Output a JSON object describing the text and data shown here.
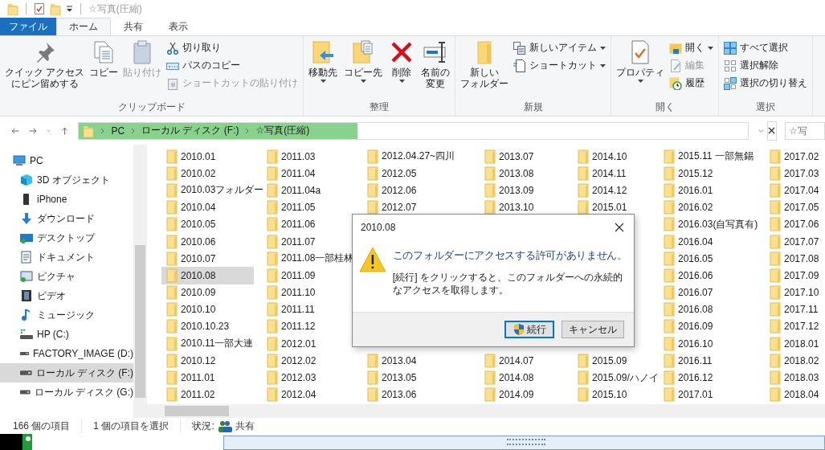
{
  "title_bar": {
    "title": "☆写真(圧縮)"
  },
  "ribbon": {
    "tabs": [
      {
        "label": "ファイル",
        "kind": "file",
        "selected": false
      },
      {
        "label": "ホーム",
        "kind": "tab",
        "selected": true
      },
      {
        "label": "共有",
        "kind": "tab",
        "selected": false
      },
      {
        "label": "表示",
        "kind": "tab",
        "selected": false
      }
    ],
    "groups": [
      {
        "label": "クリップボード",
        "large": [
          {
            "lines": [
              "クイック アクセス",
              "にピン留めする"
            ],
            "disabled": false,
            "dropdown": false
          },
          {
            "lines": [
              "コピー"
            ],
            "disabled": false,
            "dropdown": false
          },
          {
            "lines": [
              "貼り付け"
            ],
            "disabled": true,
            "dropdown": false
          }
        ],
        "small": [
          {
            "label": "切り取り",
            "disabled": false,
            "dropdown": false
          },
          {
            "label": "パスのコピー",
            "disabled": false,
            "dropdown": false
          },
          {
            "label": "ショートカットの貼り付け",
            "disabled": true,
            "dropdown": false
          }
        ]
      },
      {
        "label": "整理",
        "large": [
          {
            "lines": [
              "移動先"
            ],
            "disabled": false,
            "dropdown": true
          },
          {
            "lines": [
              "コピー先"
            ],
            "disabled": false,
            "dropdown": true
          },
          {
            "lines": [
              "削除"
            ],
            "disabled": false,
            "dropdown": true
          },
          {
            "lines": [
              "名前の",
              "変更"
            ],
            "disabled": false,
            "dropdown": false
          }
        ]
      },
      {
        "label": "新規",
        "large": [
          {
            "lines": [
              "新しい",
              "フォルダー"
            ],
            "disabled": false,
            "dropdown": false
          }
        ],
        "small": [
          {
            "label": "新しいアイテム",
            "disabled": false,
            "dropdown": true
          },
          {
            "label": "ショートカット",
            "disabled": false,
            "dropdown": true
          }
        ]
      },
      {
        "label": "開く",
        "large": [
          {
            "lines": [
              "プロパティ"
            ],
            "disabled": false,
            "dropdown": true
          }
        ],
        "small": [
          {
            "label": "開く",
            "disabled": false,
            "dropdown": true
          },
          {
            "label": "編集",
            "disabled": true,
            "dropdown": false
          },
          {
            "label": "履歴",
            "disabled": false,
            "dropdown": false
          }
        ]
      },
      {
        "label": "選択",
        "small": [
          {
            "label": "すべて選択",
            "disabled": false,
            "dropdown": false
          },
          {
            "label": "選択解除",
            "disabled": false,
            "dropdown": false
          },
          {
            "label": "選択の切り替え",
            "disabled": false,
            "dropdown": false
          }
        ]
      }
    ]
  },
  "address": {
    "highlighted": true,
    "crumbs": [
      "PC",
      "ローカル ディスク (F:)",
      "☆写真(圧縮)"
    ],
    "search_placeholder": "☆写"
  },
  "sidebar": {
    "items": [
      {
        "label": "PC",
        "selected": false,
        "children": [
          {
            "label": "3D オブジェクト",
            "selected": false
          },
          {
            "label": "iPhone",
            "selected": false
          },
          {
            "label": "ダウンロード",
            "selected": false
          },
          {
            "label": "デスクトップ",
            "selected": false
          },
          {
            "label": "ドキュメント",
            "selected": false
          },
          {
            "label": "ピクチャ",
            "selected": false
          },
          {
            "label": "ビデオ",
            "selected": false
          },
          {
            "label": "ミュージック",
            "selected": false
          },
          {
            "label": "HP (C:)",
            "selected": false
          },
          {
            "label": "FACTORY_IMAGE (D:)",
            "selected": false
          },
          {
            "label": "ローカル ディスク (F:)",
            "selected": true
          },
          {
            "label": "ローカル ディスク (G:)",
            "selected": false
          }
        ]
      }
    ]
  },
  "files": {
    "columns": [
      {
        "top": [
          {
            "name": "2010.01",
            "selected": false
          },
          {
            "name": "2010.02",
            "selected": false
          },
          {
            "name": "2010.03フォルダー",
            "selected": false
          },
          {
            "name": "2010.04",
            "selected": false
          },
          {
            "name": "2010.05",
            "selected": false
          },
          {
            "name": "2010.06",
            "selected": false
          },
          {
            "name": "2010.07",
            "selected": false
          },
          {
            "name": "2010.08",
            "selected": true
          },
          {
            "name": "2010.09",
            "selected": false
          },
          {
            "name": "2010.10",
            "selected": false
          },
          {
            "name": "2010.10.23",
            "selected": false
          },
          {
            "name": "2010.11一部大連",
            "selected": false
          },
          {
            "name": "2010.12",
            "selected": false
          },
          {
            "name": "2011.01",
            "selected": false
          },
          {
            "name": "2011.02",
            "selected": false
          }
        ]
      },
      {
        "top": [
          {
            "name": "2011.03",
            "selected": false
          },
          {
            "name": "2011.04",
            "selected": false
          },
          {
            "name": "2011.04a",
            "selected": false
          },
          {
            "name": "2011.05",
            "selected": false
          },
          {
            "name": "2011.06",
            "selected": false
          },
          {
            "name": "2011.07",
            "selected": false
          },
          {
            "name": "2011.08一部桂林",
            "selected": false
          },
          {
            "name": "2011.09",
            "selected": false
          },
          {
            "name": "2011.10",
            "selected": false
          },
          {
            "name": "2011.11",
            "selected": false
          },
          {
            "name": "2011.12",
            "selected": false
          },
          {
            "name": "2012.01",
            "selected": false
          },
          {
            "name": "2012.02",
            "selected": false
          },
          {
            "name": "2012.03",
            "selected": false
          },
          {
            "name": "2012.04",
            "selected": false
          }
        ]
      },
      {
        "top": [
          {
            "name": "2012.04.27~四川",
            "selected": false
          },
          {
            "name": "2012.05",
            "selected": false
          },
          {
            "name": "2012.06",
            "selected": false
          },
          {
            "name": "2012.07",
            "selected": false
          }
        ],
        "bottom": [
          {
            "name": "2013.04",
            "selected": false
          },
          {
            "name": "2013.05",
            "selected": false
          },
          {
            "name": "2013.06",
            "selected": false
          }
        ]
      },
      {
        "top": [
          {
            "name": "2013.07",
            "selected": false
          },
          {
            "name": "2013.08",
            "selected": false
          },
          {
            "name": "2013.09",
            "selected": false
          },
          {
            "name": "2013.10",
            "selected": false
          }
        ],
        "bottom": [
          {
            "name": "2014.07",
            "selected": false
          },
          {
            "name": "2014.08",
            "selected": false
          },
          {
            "name": "2014.09",
            "selected": false
          }
        ]
      },
      {
        "top": [
          {
            "name": "2014.10",
            "selected": false
          },
          {
            "name": "2014.11",
            "selected": false
          },
          {
            "name": "2014.12",
            "selected": false
          },
          {
            "name": "2015.01",
            "selected": false
          }
        ],
        "bottom": [
          {
            "name": "2015.09",
            "selected": false
          },
          {
            "name": "2015.09/ハノイ",
            "selected": false
          },
          {
            "name": "2015.10",
            "selected": false
          }
        ]
      },
      {
        "top": [
          {
            "name": "2015.11 一部無錫",
            "selected": false
          },
          {
            "name": "2015.12",
            "selected": false
          },
          {
            "name": "2016.01",
            "selected": false
          },
          {
            "name": "2016.02",
            "selected": false
          },
          {
            "name": "2016.03(自写真有)",
            "selected": false
          },
          {
            "name": "2016.04",
            "selected": false
          },
          {
            "name": "2016.05",
            "selected": false
          },
          {
            "name": "2016.06",
            "selected": false
          },
          {
            "name": "2016.07",
            "selected": false
          },
          {
            "name": "2016.08",
            "selected": false
          },
          {
            "name": "2016.09",
            "selected": false
          },
          {
            "name": "2016.10",
            "selected": false
          },
          {
            "name": "2016.11",
            "selected": false
          },
          {
            "name": "2016.12",
            "selected": false
          },
          {
            "name": "2017.01",
            "selected": false
          }
        ]
      },
      {
        "top": [
          {
            "name": "2017.02",
            "selected": false
          },
          {
            "name": "2017.03",
            "selected": false
          },
          {
            "name": "2017.04",
            "selected": false
          },
          {
            "name": "2017.05",
            "selected": false
          },
          {
            "name": "2017.06",
            "selected": false
          },
          {
            "name": "2017.07",
            "selected": false
          },
          {
            "name": "2017.08",
            "selected": false
          },
          {
            "name": "2017.09",
            "selected": false
          },
          {
            "name": "2017.10",
            "selected": false
          },
          {
            "name": "2017.11",
            "selected": false
          },
          {
            "name": "2017.12",
            "selected": false
          },
          {
            "name": "2018.01",
            "selected": false
          },
          {
            "name": "2018.02",
            "selected": false
          },
          {
            "name": "2018.03",
            "selected": false
          },
          {
            "name": "2018.04",
            "selected": false
          }
        ]
      }
    ]
  },
  "status_bar": {
    "item_count": "166 個の項目",
    "selection": "1 個の項目を選択",
    "state_label": "状況:",
    "state_value": "共有"
  },
  "dialog": {
    "title": "2010.08",
    "heading": "このフォルダーにアクセスする許可がありません。",
    "message": "[続行] をクリックすると、このフォルダーへの永続的なアクセスを取得します。",
    "buttons": [
      {
        "label": "続行",
        "kind": "elevated",
        "default": true
      },
      {
        "label": "キャンセル",
        "kind": "plain",
        "default": false
      }
    ]
  }
}
